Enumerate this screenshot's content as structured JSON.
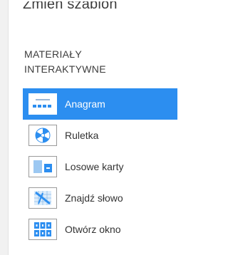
{
  "sidebar": {
    "change_template": "Zmień szablon",
    "section_heading": "MATERIAŁY INTERAKTYWNE",
    "items": [
      {
        "label": "Anagram",
        "icon": "anagram-icon",
        "active": true
      },
      {
        "label": "Ruletka",
        "icon": "wheel-icon",
        "active": false
      },
      {
        "label": "Losowe karty",
        "icon": "random-cards-icon",
        "active": false
      },
      {
        "label": "Znajdź słowo",
        "icon": "word-search-icon",
        "active": false
      },
      {
        "label": "Otwórz okno",
        "icon": "open-box-icon",
        "active": false
      }
    ]
  },
  "colors": {
    "active_background": "#2c8ef0",
    "icon_blue": "#2c8ef0",
    "text": "#333333"
  }
}
